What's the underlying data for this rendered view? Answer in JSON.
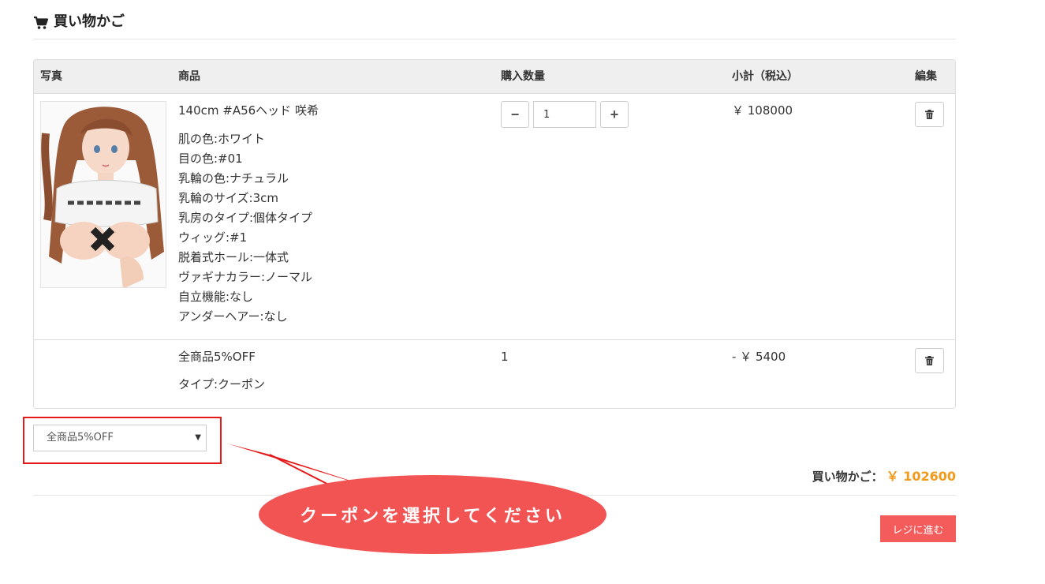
{
  "header": {
    "title": "買い物かご",
    "icon": "cart-icon"
  },
  "table": {
    "columns": [
      "写真",
      "商品",
      "購入数量",
      "小計（税込）",
      "編集"
    ],
    "items": [
      {
        "name": "140cm #A56ヘッド 咲希",
        "options": [
          "肌の色:ホワイト",
          "目の色:#01",
          "乳輪の色:ナチュラル",
          "乳輪のサイズ:3cm",
          "乳房のタイプ:個体タイプ",
          "ウィッグ:#1",
          "脱着式ホール:一体式",
          "ヴァギナカラー:ノーマル",
          "自立機能:なし",
          "アンダーヘアー:なし"
        ],
        "quantity": "1",
        "qty_minus": "−",
        "qty_plus": "+",
        "subtotal": "￥ 108000"
      },
      {
        "name": "全商品5%OFF",
        "type": "タイプ:クーポン",
        "quantity": "1",
        "subtotal": "- ￥ 5400"
      }
    ]
  },
  "coupon": {
    "selected": "全商品5%OFF",
    "arrow": "▼"
  },
  "summary": {
    "label": "買い物かご：",
    "amount": "￥ 102600"
  },
  "annotation": {
    "text": "クーポンを選択してください"
  },
  "checkout": {
    "label": "レジに進む"
  },
  "colors": {
    "accent": "#f45b5b",
    "total": "#f39a1b",
    "highlight": "#e61919"
  }
}
